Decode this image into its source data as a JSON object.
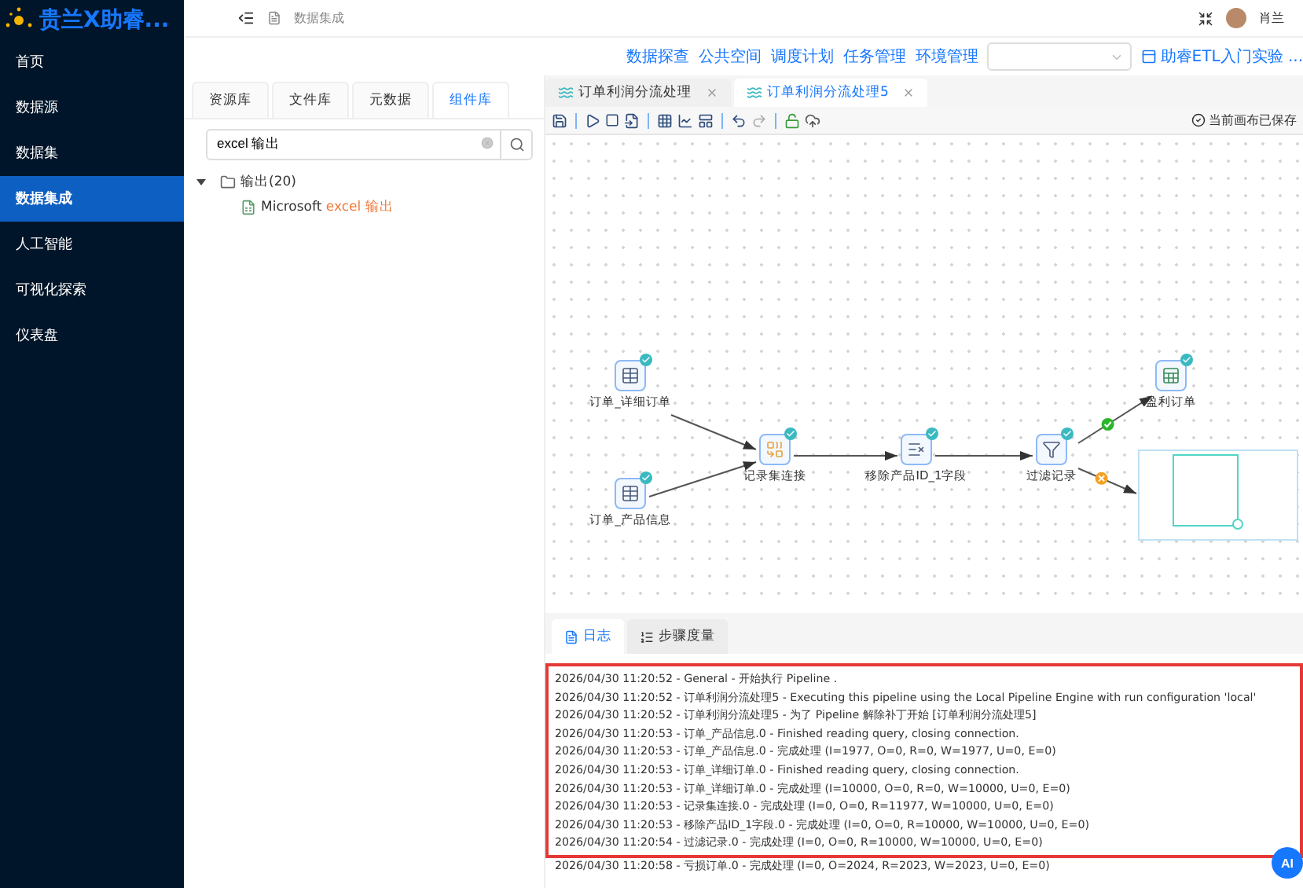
{
  "sidebar": {
    "logo_text": "贵兰X助睿...",
    "items": [
      {
        "label": "首页",
        "selected": false
      },
      {
        "label": "数据源",
        "selected": false
      },
      {
        "label": "数据集",
        "selected": false
      },
      {
        "label": "数据集成",
        "selected": true
      },
      {
        "label": "人工智能",
        "selected": false
      },
      {
        "label": "可视化探索",
        "selected": false
      },
      {
        "label": "仪表盘",
        "selected": false
      }
    ]
  },
  "header": {
    "breadcrumb": "数据集成",
    "user_name": "肖兰"
  },
  "top_links": [
    "数据探查",
    "公共空间",
    "调度计划",
    "任务管理",
    "环境管理"
  ],
  "guide_link": "助睿ETL入门实验 ...",
  "left_panel": {
    "tabs": [
      {
        "label": "资源库",
        "selected": false
      },
      {
        "label": "文件库",
        "selected": false
      },
      {
        "label": "元数据",
        "selected": false
      },
      {
        "label": "组件库",
        "selected": true
      }
    ],
    "search": {
      "value": "excel 输出"
    },
    "tree": [
      {
        "label": "输出(20)",
        "expanded": true,
        "children": [
          {
            "parts": [
              {
                "text": "Microsoft ",
                "highlight": false
              },
              {
                "text": "excel 输出",
                "highlight": true
              }
            ]
          }
        ]
      }
    ]
  },
  "editor": {
    "tabs": [
      {
        "label": "订单利润分流处理",
        "selected": false
      },
      {
        "label": "订单利润分流处理5",
        "selected": true
      }
    ],
    "saved_status": "当前画布已保存",
    "nodes": [
      {
        "label": "订单_详细订单",
        "kind": "table-input",
        "done": true
      },
      {
        "label": "订单_产品信息",
        "kind": "table-input",
        "done": true
      },
      {
        "label": "记录集连接",
        "kind": "join",
        "done": true
      },
      {
        "label": "移除产品ID_1字段",
        "kind": "select",
        "done": true
      },
      {
        "label": "过滤记录",
        "kind": "filter",
        "done": true
      },
      {
        "label": "盈利订单",
        "kind": "excel-output",
        "done": true
      }
    ],
    "hops": [
      {
        "kind": "plain"
      },
      {
        "kind": "plain"
      },
      {
        "kind": "plain"
      },
      {
        "kind": "plain"
      },
      {
        "kind": "success"
      },
      {
        "kind": "error"
      }
    ],
    "bottom_tabs": [
      {
        "label": "日志",
        "selected": true
      },
      {
        "label": "步骤度量",
        "selected": false
      }
    ],
    "log_lines": [
      "2026/04/30 11:20:52 - General - 开始执行 Pipeline .",
      "2026/04/30 11:20:52 - 订单利润分流处理5 - Executing this pipeline using the Local Pipeline Engine with run configuration 'local'",
      "2026/04/30 11:20:52 - 订单利润分流处理5 - 为了 Pipeline 解除补丁开始 [订单利润分流处理5]",
      "2026/04/30 11:20:53 - 订单_产品信息.0 - Finished reading query, closing connection.",
      "2026/04/30 11:20:53 - 订单_产品信息.0 - 完成处理 (I=1977, O=0, R=0, W=1977, U=0, E=0)",
      "2026/04/30 11:20:53 - 订单_详细订单.0 - Finished reading query, closing connection.",
      "2026/04/30 11:20:53 - 订单_详细订单.0 - 完成处理 (I=10000, O=0, R=0, W=10000, U=0, E=0)",
      "2026/04/30 11:20:53 - 记录集连接.0 - 完成处理 (I=0, O=0, R=11977, W=10000, U=0, E=0)",
      "2026/04/30 11:20:53 - 移除产品ID_1字段.0 - 完成处理 (I=0, O=0, R=10000, W=10000, U=0, E=0)",
      "2026/04/30 11:20:54 - 过滤记录.0 - 完成处理 (I=0, O=0, R=10000, W=10000, U=0, E=0)"
    ],
    "log_overflow_line": "2026/04/30 11:20:58 - 亏损订单.0 - 完成处理 (I=0, O=2024, R=2023, W=2023, U=0, E=0)",
    "ai_button": "AI"
  }
}
